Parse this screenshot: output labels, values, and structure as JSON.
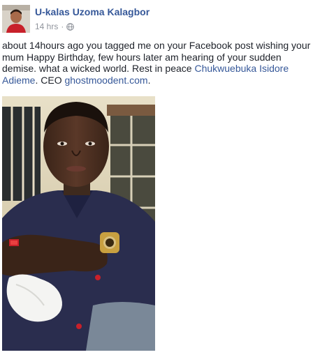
{
  "post": {
    "author": "U-kalas Uzoma Kalagbor",
    "time": "14 hrs",
    "separator": "·",
    "privacy_icon": "globe-icon",
    "text_before_tag": "about 14hours ago you tagged me on your Facebook post wishing your mum Happy Birthday, few hours later am hearing of your sudden demise. what a wicked world. Rest in peace ",
    "tagged_name": "Chukwuebuka Isidore Adieme",
    "text_after_tag": ". CEO ",
    "link": "ghostmoodent.com",
    "text_end": "."
  },
  "colors": {
    "link": "#365899",
    "text": "#1d2129",
    "meta": "#90949c"
  }
}
